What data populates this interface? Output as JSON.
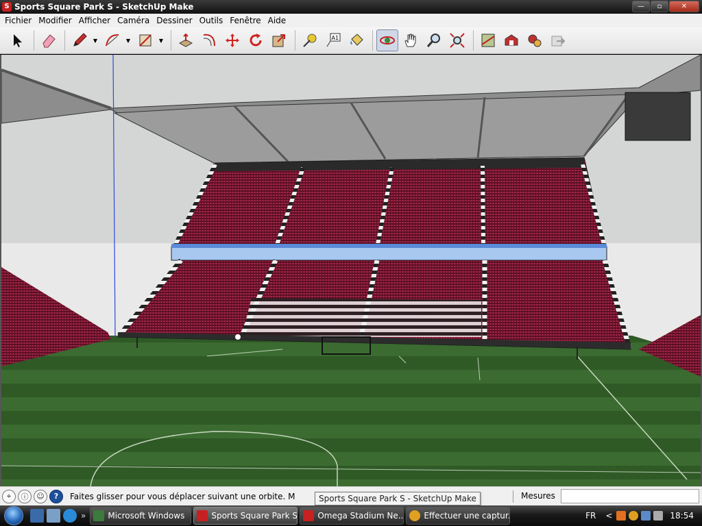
{
  "window": {
    "title": "Sports Square Park S - SketchUp Make",
    "minimize": "—",
    "maximize": "▫",
    "close": "✕"
  },
  "menu": [
    "Fichier",
    "Modifier",
    "Afficher",
    "Caméra",
    "Dessiner",
    "Outils",
    "Fenêtre",
    "Aide"
  ],
  "toolbar": {
    "tools": [
      {
        "name": "select-tool",
        "icon": "arrow-icon"
      },
      {
        "name": "eraser-tool",
        "icon": "eraser-icon"
      },
      {
        "name": "pencil-tool",
        "icon": "pencil-icon",
        "dropdown": true
      },
      {
        "name": "arc-tool",
        "icon": "arc-icon",
        "dropdown": true
      },
      {
        "name": "rectangle-tool",
        "icon": "rectangle-icon",
        "dropdown": true
      },
      {
        "name": "push-pull-tool",
        "icon": "push-pull-icon"
      },
      {
        "name": "offset-tool",
        "icon": "offset-icon"
      },
      {
        "name": "move-tool",
        "icon": "move-icon"
      },
      {
        "name": "rotate-tool",
        "icon": "rotate-icon"
      },
      {
        "name": "scale-tool",
        "icon": "scale-icon"
      },
      {
        "name": "tape-measure-tool",
        "icon": "tape-icon"
      },
      {
        "name": "text-tool",
        "icon": "text-icon",
        "label": "A1"
      },
      {
        "name": "paint-bucket-tool",
        "icon": "bucket-icon"
      },
      {
        "name": "orbit-tool",
        "icon": "orbit-icon",
        "active": true
      },
      {
        "name": "pan-tool",
        "icon": "hand-icon"
      },
      {
        "name": "zoom-tool",
        "icon": "magnifier-icon"
      },
      {
        "name": "zoom-extents-tool",
        "icon": "zoom-extents-icon"
      },
      {
        "name": "add-location-tool",
        "icon": "map-icon"
      },
      {
        "name": "3d-warehouse-tool",
        "icon": "warehouse-icon"
      },
      {
        "name": "extension-warehouse-tool",
        "icon": "extension-icon"
      },
      {
        "name": "share-model-tool",
        "icon": "share-icon"
      }
    ]
  },
  "status": {
    "text": "Faites glisser pour vous déplacer suivant une orbite.  M",
    "tooltip": "Sports Square Park S - SketchUp Make",
    "measures_label": "Mesures",
    "measures_value": ""
  },
  "taskbar": {
    "tasks": [
      {
        "label": "Microsoft Windows",
        "color": "#3d7a3d"
      },
      {
        "label": "Sports Square Park S...",
        "color": "#c82020",
        "active": true
      },
      {
        "label": "Omega Stadium Ne...",
        "color": "#c82020"
      },
      {
        "label": "Effectuer une captur...",
        "color": "#e0a020"
      }
    ],
    "quick_more": "»",
    "lang": "FR",
    "tray_arrow": "<",
    "clock": "18:54"
  },
  "colors": {
    "seat": "#8a1c3a",
    "grass_dark": "#2f5a26",
    "grass_light": "#3b6b30",
    "roof": "#8f8f8f",
    "sky": "#e8e8e8",
    "concourse": "#a8c8f0"
  }
}
